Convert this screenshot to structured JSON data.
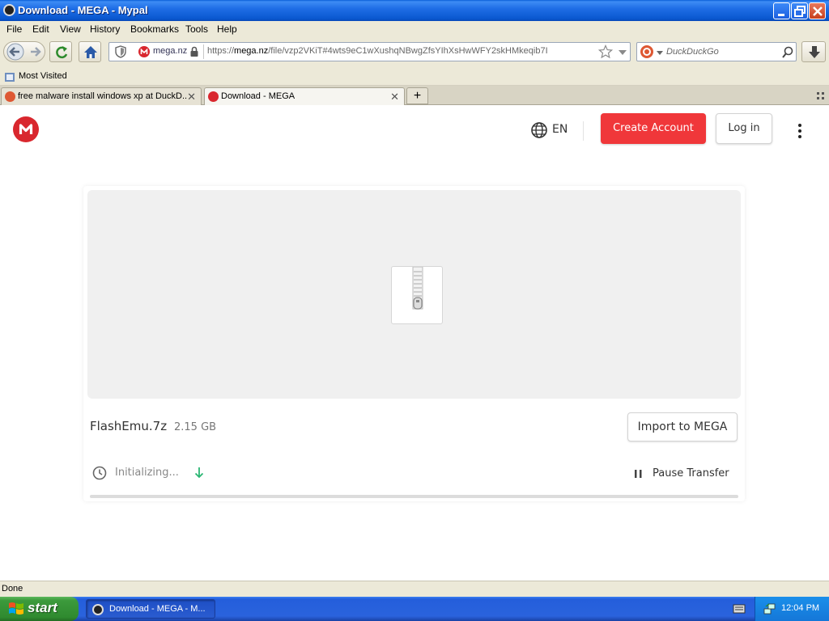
{
  "window": {
    "title": "Download - MEGA - Mypal",
    "controls": {
      "minimize": "minimize-icon",
      "maximize": "restore-icon",
      "close": "close-icon"
    }
  },
  "menu": [
    "File",
    "Edit",
    "View",
    "History",
    "Bookmarks",
    "Tools",
    "Help"
  ],
  "nav": {
    "site_label": "mega.nz",
    "url_prefix": "https://",
    "url_host": "mega.nz",
    "url_path": "/file/vzp2VKiT#4wts9eC1wXushqNBwgZfsYIhXsHwWFY2skHMkeqib7I",
    "search_placeholder": "DuckDuckGo"
  },
  "bookmarks": {
    "most_visited": "Most Visited"
  },
  "tabs": [
    {
      "label": "free malware install windows xp at DuckD...",
      "active": false
    },
    {
      "label": "Download - MEGA",
      "active": true
    }
  ],
  "page": {
    "lang": "EN",
    "create_account": "Create Account",
    "login": "Log in",
    "file_name": "FlashEmu.7z",
    "file_size": "2.15 GB",
    "import": "Import to MEGA",
    "status": "Initializing...",
    "pause": "Pause Transfer",
    "progress_fraction": 0
  },
  "statusbar": {
    "text": "Done"
  },
  "taskbar": {
    "start": "start",
    "item": "Download - MEGA - M...",
    "clock": "12:04 PM"
  },
  "colors": {
    "mega_red": "#d9272e",
    "create_button": "#f0373a",
    "xp_blue": "#245edb",
    "start_green": "#3c9a3c"
  }
}
